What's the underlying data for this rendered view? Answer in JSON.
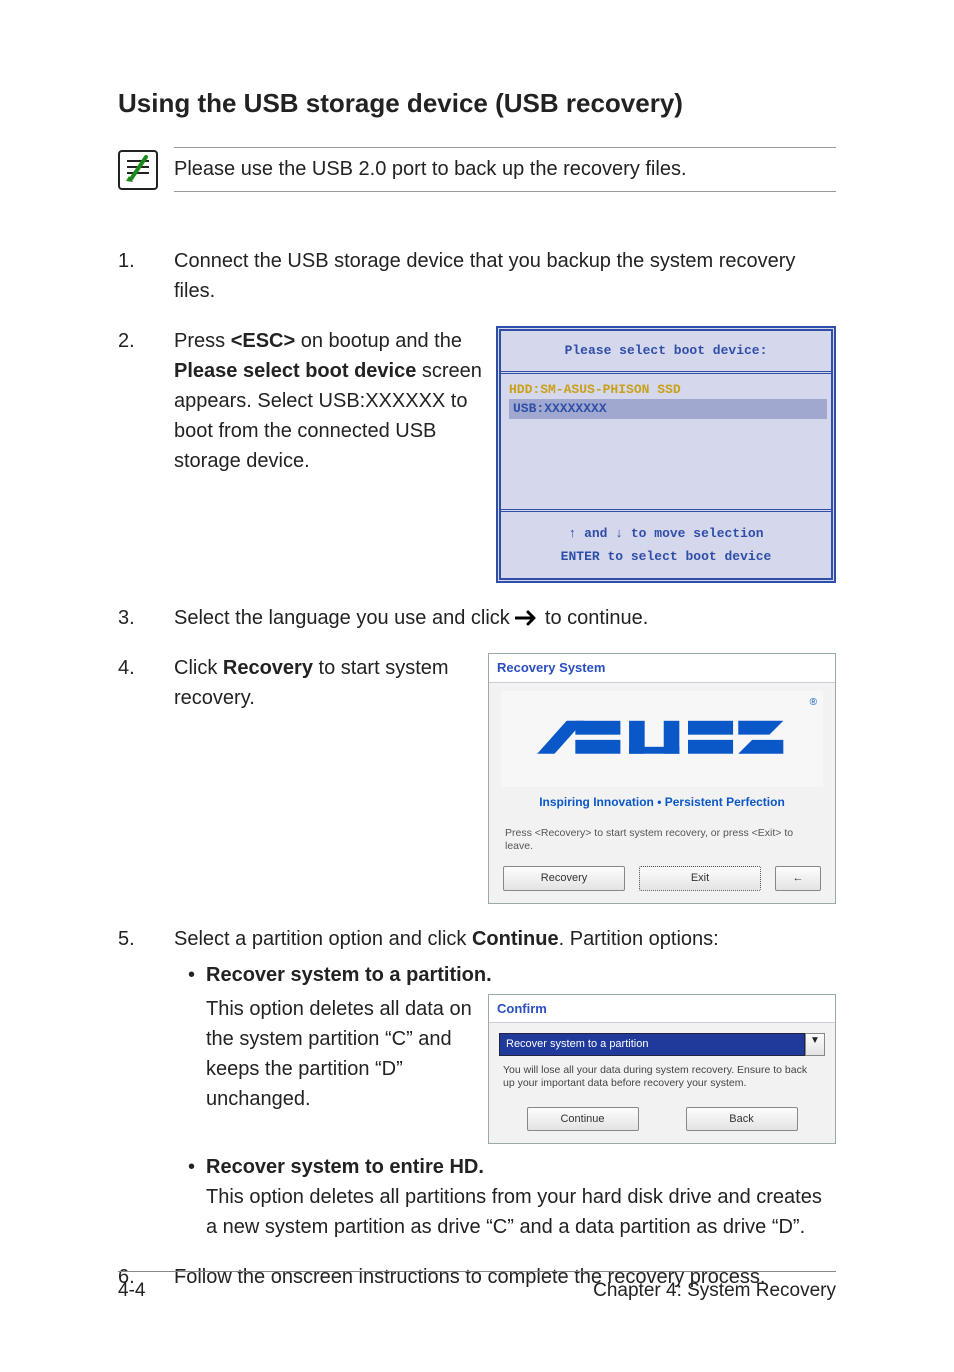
{
  "heading": "Using the USB storage device (USB recovery)",
  "note": "Please use the USB 2.0 port to back up the recovery files.",
  "steps": {
    "s1": {
      "num": "1.",
      "text": "Connect the USB storage device that you backup the system recovery files."
    },
    "s2": {
      "num": "2.",
      "pre": "Press ",
      "esc": "<ESC>",
      "mid1": " on bootup and the ",
      "bold": "Please select boot device",
      "mid2": " screen appears. Select USB:XXXXXX to boot from the connected USB storage device."
    },
    "s3": {
      "num": "3.",
      "pre": "Select the language you use and click ",
      "post": " to continue."
    },
    "s4": {
      "num": "4.",
      "pre": "Click ",
      "bold": "Recovery",
      "post": " to start system recovery."
    },
    "s5": {
      "num": "5.",
      "pre": "Select a partition option and click ",
      "bold": "Continue",
      "post": ". Partition options:",
      "opt1_title": "Recover system to a partition.",
      "opt1_body": "This option deletes all data on the system partition “C” and keeps the partition “D” unchanged.",
      "opt2_title": "Recover system to entire HD.",
      "opt2_body": "This option deletes all partitions from your hard disk drive and creates a new system partition as drive “C” and a data partition as drive “D”."
    },
    "s6": {
      "num": "6.",
      "text": "Follow the onscreen instructions to complete the recovery process."
    }
  },
  "bios": {
    "title": "Please select boot device:",
    "hdd": "HDD:SM-ASUS-PHISON SSD",
    "usb": "USB:XXXXXXXX",
    "hint1": "↑ and ↓ to move selection",
    "hint2": "ENTER to select boot device"
  },
  "recwin": {
    "title": "Recovery System",
    "tagline": "Inspiring Innovation • Persistent Perfection",
    "prompt": "Press <Recovery> to start system recovery, or press <Exit> to leave.",
    "btn_recovery": "Recovery",
    "btn_exit": "Exit",
    "reg": "®"
  },
  "confirm": {
    "title": "Confirm",
    "combo": "Recover system to a partition",
    "msg": "You will lose all your data during system recovery. Ensure to back up your important data before recovery your system.",
    "btn_continue": "Continue",
    "btn_back": "Back",
    "chevron": "▼"
  },
  "footer": {
    "left": "4-4",
    "right": "Chapter 4: System Recovery"
  },
  "icons": {
    "note": "note-icon",
    "arrow_right": "→",
    "arrow_left": "←"
  }
}
